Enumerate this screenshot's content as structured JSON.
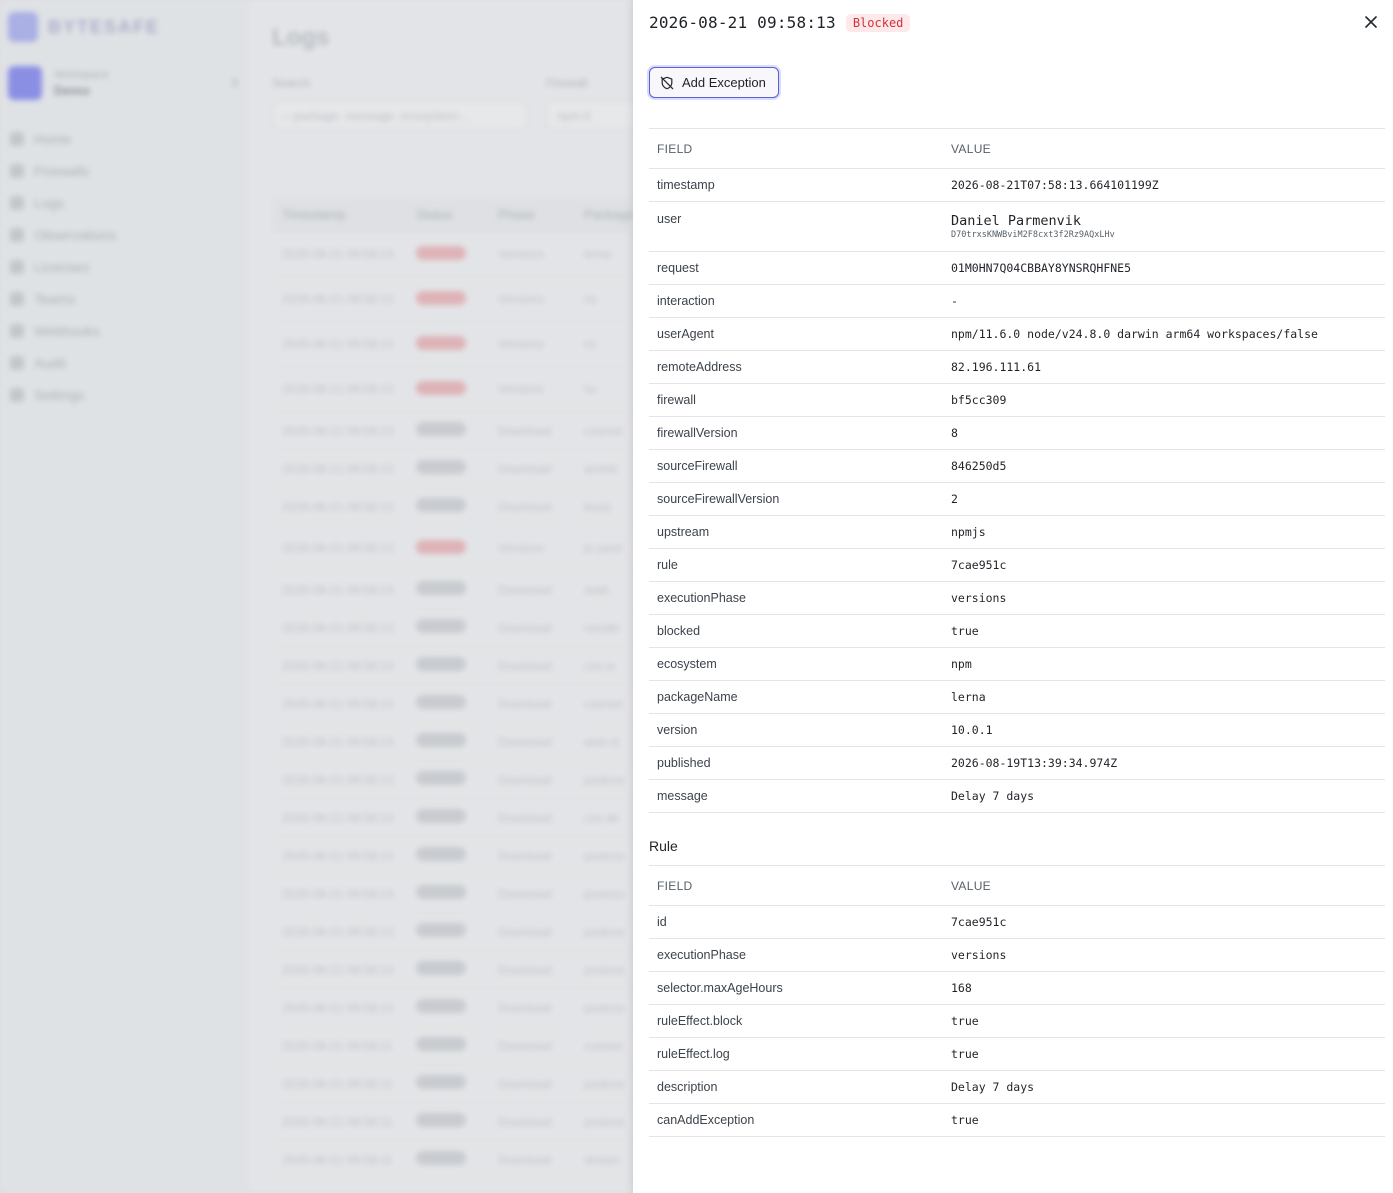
{
  "background": {
    "brand": "BYTESAFE",
    "workspace": {
      "label": "Workspace",
      "name": "Demo"
    },
    "nav": [
      "Home",
      "Firewalls",
      "Logs",
      "Observations",
      "Licenses",
      "Teams",
      "Webhooks",
      "Audit",
      "Settings"
    ],
    "page_title": "Logs",
    "search_label": "Search",
    "search_placeholder": "package, message, ecosystem…",
    "firewall_label": "Firewall",
    "firewall_value": "npm-it",
    "table_headers": [
      "Timestamp",
      "Status",
      "Phase",
      "Package"
    ],
    "rows": [
      {
        "ts": "2026-08-21 09:58:13",
        "status": "Blocked",
        "phase": "Versions",
        "pkg": "lerna"
      },
      {
        "ts": "2026-08-21 09:58:13",
        "status": "Blocked",
        "phase": "Versions",
        "pkg": "nx"
      },
      {
        "ts": "2026-08-21 09:58:13",
        "status": "Blocked",
        "phase": "Versions",
        "pkg": "nx"
      },
      {
        "ts": "2026-08-21 09:58:13",
        "status": "Blocked",
        "phase": "Versions",
        "pkg": "nx"
      },
      {
        "ts": "2026-08-21 09:58:13",
        "status": "Allowed",
        "phase": "Download",
        "pkg": "cosmet"
      },
      {
        "ts": "2026-08-21 09:58:13",
        "status": "Allowed",
        "phase": "Download",
        "pkg": "archet"
      },
      {
        "ts": "2026-08-21 09:58:13",
        "status": "Allowed",
        "phase": "Download",
        "pkg": "basic"
      },
      {
        "ts": "2026-08-21 09:58:13",
        "status": "Blocked",
        "phase": "Versions",
        "pkg": "js-yaml"
      },
      {
        "ts": "2026-08-21 09:58:13",
        "status": "Allowed",
        "phase": "Download",
        "pkg": "stats"
      },
      {
        "ts": "2026-08-21 09:58:13",
        "status": "Allowed",
        "phase": "Download",
        "pkg": "needle"
      },
      {
        "ts": "2026-08-21 09:58:13",
        "status": "Allowed",
        "phase": "Download",
        "pkg": "css-w"
      },
      {
        "ts": "2026-08-21 09:58:13",
        "status": "Allowed",
        "phase": "Download",
        "pkg": "cosmet"
      },
      {
        "ts": "2026-08-21 09:58:13",
        "status": "Allowed",
        "phase": "Download",
        "pkg": "web-st"
      },
      {
        "ts": "2026-08-21 09:58:13",
        "status": "Allowed",
        "phase": "Download",
        "pkg": "postcss"
      },
      {
        "ts": "2026-08-21 09:58:13",
        "status": "Allowed",
        "phase": "Download",
        "pkg": "css-de"
      },
      {
        "ts": "2026-08-21 09:58:13",
        "status": "Allowed",
        "phase": "Download",
        "pkg": "postcss"
      },
      {
        "ts": "2026-08-21 09:58:13",
        "status": "Allowed",
        "phase": "Download",
        "pkg": "postcss"
      },
      {
        "ts": "2026-08-21 09:58:13",
        "status": "Allowed",
        "phase": "Download",
        "pkg": "postcss"
      },
      {
        "ts": "2026-08-21 09:58:13",
        "status": "Allowed",
        "phase": "Download",
        "pkg": "postcss"
      },
      {
        "ts": "2026-08-21 09:58:13",
        "status": "Allowed",
        "phase": "Download",
        "pkg": "postcss"
      },
      {
        "ts": "2026-08-21 09:58:11",
        "status": "Allowed",
        "phase": "Download",
        "pkg": "cosmet"
      },
      {
        "ts": "2026-08-21 09:58:11",
        "status": "Allowed",
        "phase": "Download",
        "pkg": "postcss"
      },
      {
        "ts": "2026-08-21 09:58:11",
        "status": "Allowed",
        "phase": "Download",
        "pkg": "postcss"
      },
      {
        "ts": "2026-08-21 09:58:11",
        "status": "Allowed",
        "phase": "Download",
        "pkg": "stream"
      }
    ]
  },
  "drawer": {
    "title": "2026-08-21 09:58:13",
    "status_badge": "Blocked",
    "add_exception_label": "Add Exception",
    "close_icon": "close-icon",
    "exception_icon": "shield-off-icon",
    "col_field": "FIELD",
    "col_value": "VALUE",
    "log_fields": [
      {
        "key": "timestamp",
        "value": "2026-08-21T07:58:13.664101199Z"
      },
      {
        "key": "user",
        "value": "Daniel Parmenvik",
        "sub": "D70trxsKNWBviM2F8cxt3f2Rz9AQxLHv"
      },
      {
        "key": "request",
        "value": "01M0HN7Q04CBBAY8YNSRQHFNE5"
      },
      {
        "key": "interaction",
        "value": "-"
      },
      {
        "key": "userAgent",
        "value": "npm/11.6.0 node/v24.8.0 darwin arm64 workspaces/false"
      },
      {
        "key": "remoteAddress",
        "value": "82.196.111.61"
      },
      {
        "key": "firewall",
        "value": "bf5cc309"
      },
      {
        "key": "firewallVersion",
        "value": "8"
      },
      {
        "key": "sourceFirewall",
        "value": "846250d5"
      },
      {
        "key": "sourceFirewallVersion",
        "value": "2"
      },
      {
        "key": "upstream",
        "value": "npmjs"
      },
      {
        "key": "rule",
        "value": "7cae951c"
      },
      {
        "key": "executionPhase",
        "value": "versions"
      },
      {
        "key": "blocked",
        "value": "true"
      },
      {
        "key": "ecosystem",
        "value": "npm"
      },
      {
        "key": "packageName",
        "value": "lerna"
      },
      {
        "key": "version",
        "value": "10.0.1"
      },
      {
        "key": "published",
        "value": "2026-08-19T13:39:34.974Z"
      },
      {
        "key": "message",
        "value": "Delay 7 days"
      }
    ],
    "rule_section_title": "Rule",
    "rule_fields": [
      {
        "key": "id",
        "value": "7cae951c"
      },
      {
        "key": "executionPhase",
        "value": "versions"
      },
      {
        "key": "selector.maxAgeHours",
        "value": "168"
      },
      {
        "key": "ruleEffect.block",
        "value": "true"
      },
      {
        "key": "ruleEffect.log",
        "value": "true"
      },
      {
        "key": "description",
        "value": "Delay 7 days"
      },
      {
        "key": "canAddException",
        "value": "true"
      }
    ]
  },
  "colors": {
    "accent": "#5b5fd6",
    "blocked_text": "#d1343b",
    "blocked_bg": "#fde8ea"
  }
}
